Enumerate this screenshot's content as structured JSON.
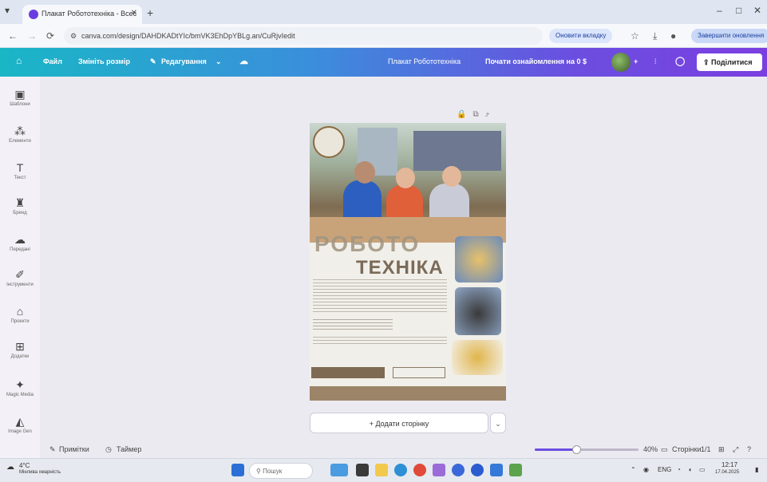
{
  "browser": {
    "tab_title": "Плакат Робототехніка - Всес",
    "new_tab": "+",
    "url": "canva.com/design/DAHDKADtYIc/bmVK3EhDpYBLg.an/CuRjvIedit",
    "win_minimize": "–",
    "win_maximize": "□",
    "win_close": "✕",
    "nav_back": "←",
    "nav_forward": "→",
    "nav_reload": "⟳",
    "update_pill": "Оновити вкладку",
    "profile_pill": "Завершити оновлення"
  },
  "canva": {
    "file_menu": "Файл",
    "resize": "Змініть розмір",
    "editing": "Редагування",
    "design_title": "Плакат Робототехніка",
    "trial": "Почати ознайомлення на 0 $",
    "share": "Поділитися",
    "sidebar": [
      {
        "icon": "templates-icon",
        "label": "Шаблони"
      },
      {
        "icon": "elements-icon",
        "label": "Елементи"
      },
      {
        "icon": "text-icon",
        "label": "Текст"
      },
      {
        "icon": "brand-icon",
        "label": "Бренд"
      },
      {
        "icon": "uploads-icon",
        "label": "Передані"
      },
      {
        "icon": "tools-icon",
        "label": "Інструменти"
      },
      {
        "icon": "projects-icon",
        "label": "Проекти"
      },
      {
        "icon": "apps-icon",
        "label": "Додатки"
      },
      {
        "icon": "magic-media-icon",
        "label": "Magic Media"
      },
      {
        "icon": "image-gen-icon",
        "label": "Image Gen"
      }
    ],
    "add_page": "+ Додати сторінку",
    "notes": "Примітки",
    "timer": "Таймер",
    "zoom": "40%",
    "zoom_fraction": 0.4,
    "pages": "Сторінки",
    "page_count": "1/1"
  },
  "poster": {
    "title_top": "РОБОТО",
    "title_main": "ТЕХНІКА"
  },
  "taskbar": {
    "weather_temp": "4°C",
    "weather_desc": "Мінлива хмарність",
    "search": "Пошук",
    "time": "12:17",
    "date": "17.04.2025"
  }
}
